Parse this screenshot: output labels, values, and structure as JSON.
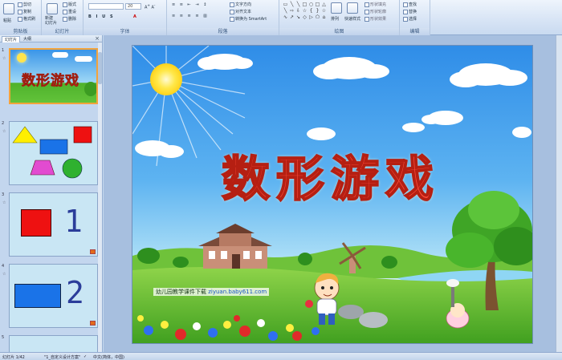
{
  "ribbon": {
    "groups": [
      {
        "label": "剪贴板"
      },
      {
        "label": "幻灯片"
      },
      {
        "label": "字体"
      },
      {
        "label": "段落"
      },
      {
        "label": "绘图"
      },
      {
        "label": "编辑"
      }
    ],
    "clipboard": {
      "paste": "粘贴",
      "cut": "剪切",
      "copy": "复制",
      "format_painter": "格式刷"
    },
    "slides": {
      "new_slide": "新建\n幻灯片",
      "layout": "版式",
      "reset": "重设",
      "delete": "删除"
    },
    "font": {
      "size": "20"
    },
    "paragraph": {
      "text_direction": "文字方向",
      "align_text": "对齐文本",
      "smartart": "转换为 SmartArt"
    },
    "drawing": {
      "arrange": "排列",
      "quick_styles": "快速样式",
      "fill": "形状填充",
      "outline": "形状轮廓",
      "effects": "形状效果"
    },
    "editing": {
      "find": "查找",
      "replace": "替换",
      "select": "选择"
    }
  },
  "panel": {
    "tab_slides": "幻灯片",
    "tab_outline": "大纲",
    "close": "×"
  },
  "thumbnails": [
    {
      "number": "1",
      "title": "数形游戏"
    },
    {
      "number": "2"
    },
    {
      "number": "3",
      "digit": "1"
    },
    {
      "number": "4",
      "digit": "2"
    },
    {
      "number": "5"
    }
  ],
  "slide": {
    "title": "数形游戏",
    "caption_prefix": "幼儿园教学课件下载",
    "caption_link": "ziyuan.baby611.com"
  },
  "status": {
    "slide_count": "幻灯片 1/42",
    "theme": "\"1_自定义设计方案\"",
    "language": "中文(简体，中国)"
  },
  "colors": {
    "title": "#ff4d3a",
    "selected_border": "#f3a33b",
    "sky": "#2f8de8",
    "grass": "#4fb22c"
  }
}
